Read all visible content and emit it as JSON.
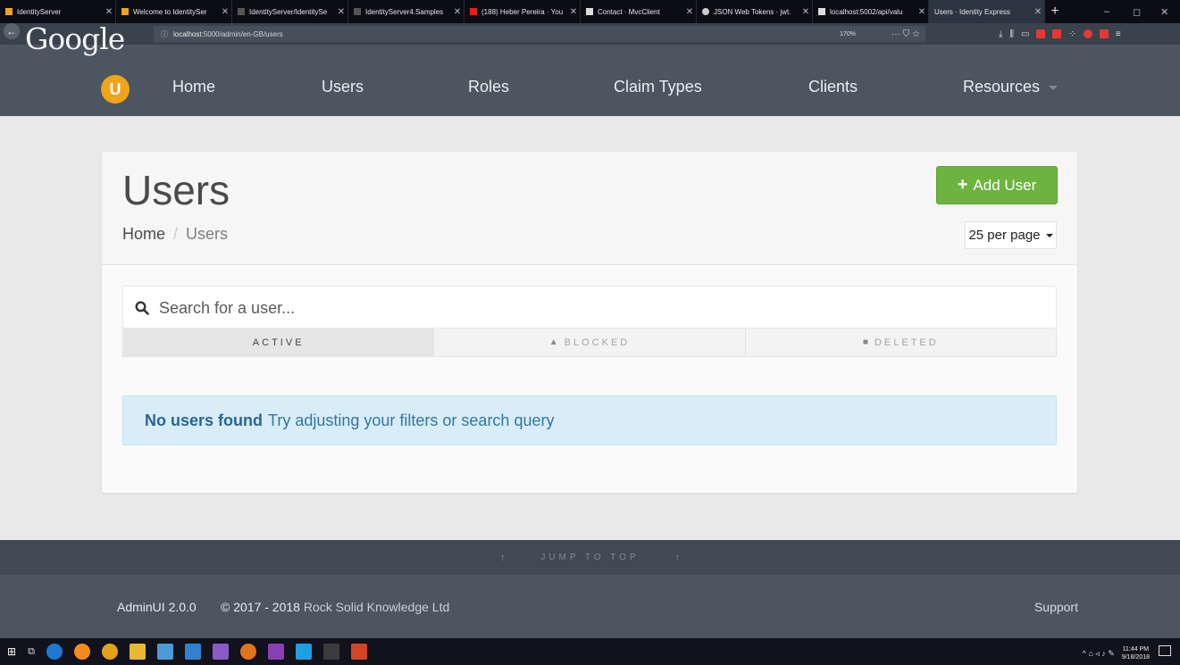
{
  "browser": {
    "tabs": [
      {
        "label": "IdentityServer",
        "color": "#f0a31b",
        "active": false
      },
      {
        "label": "Welcome to IdentitySer",
        "color": "#f0a31b",
        "active": false
      },
      {
        "label": "IdentityServer/IdentitySe",
        "color": "#555555",
        "active": false
      },
      {
        "label": "IdentityServer4.Samples",
        "color": "#555555",
        "active": false
      },
      {
        "label": "(188) Heber Pereira · You",
        "color": "#e62117",
        "active": false
      },
      {
        "label": "Contact · MvcClient",
        "color": "#dddddd",
        "active": false
      },
      {
        "label": "JSON Web Tokens · jwt.",
        "color": "#cccccc",
        "active": false
      },
      {
        "label": "localhost:5002/api/valu",
        "color": "#dddddd",
        "active": false
      },
      {
        "label": "Users · Identity Express",
        "color": "#2b3440",
        "active": true
      }
    ],
    "new_tab": "+",
    "window_controls": [
      "–",
      "◻",
      "✕"
    ],
    "url_host": "localhost",
    "url_path": ":5000/admin/en-GB/users",
    "zoom": "170%",
    "page_actions": "··· ⛉ ☆",
    "overlay_logo": "Google",
    "back": "←"
  },
  "navbar": {
    "logo_letter": "U",
    "links": [
      "Home",
      "Users",
      "Roles",
      "Claim Types",
      "Clients",
      "Resources"
    ]
  },
  "page": {
    "title": "Users",
    "breadcrumb": {
      "home": "Home",
      "separator": "/",
      "current": "Users"
    },
    "add_button": "Add User",
    "per_page": "25 per page",
    "search_placeholder": "Search for a user...",
    "filters": [
      {
        "label": "ACTIVE",
        "icon": "",
        "active": true
      },
      {
        "label": "BLOCKED",
        "icon": "▲",
        "active": false
      },
      {
        "label": "DELETED",
        "icon": "■",
        "active": false
      }
    ],
    "empty_title": "No users found",
    "empty_message": "Try adjusting your filters or search query"
  },
  "jump": {
    "label": "JUMP TO TOP",
    "arrow": "↑"
  },
  "footer": {
    "version": "AdminUI 2.0.0",
    "copyright_prefix": "© 2017 - 2018",
    "company": "Rock Solid Knowledge Ltd",
    "support": "Support"
  },
  "taskbar": {
    "clock_time": "11:44 PM",
    "clock_date": "9/18/2018",
    "tray": "^ ⌂ ◃ ♪ ✎"
  },
  "colors": {
    "navbar": "#4b5661",
    "accent_green": "#6db33f",
    "logo_orange": "#f0a31b",
    "alert_bg": "#d8edf7",
    "alert_text": "#3276a1"
  }
}
